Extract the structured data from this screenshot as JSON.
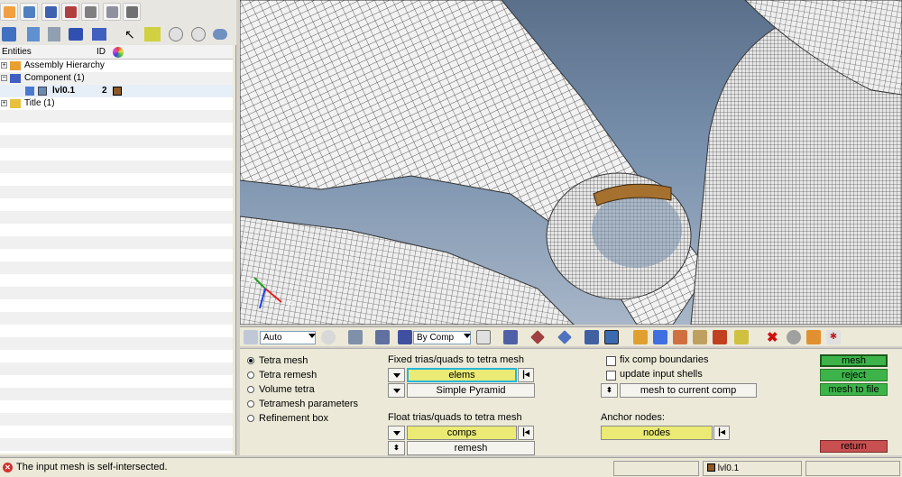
{
  "browser": {
    "header": {
      "entities": "Entities",
      "id": "ID"
    },
    "tree": [
      {
        "label": "Assembly Hierarchy",
        "id": ""
      },
      {
        "label": "Component (1)",
        "id": ""
      },
      {
        "label": "lvl0.1",
        "id": "2"
      },
      {
        "label": "Title (1)",
        "id": ""
      }
    ]
  },
  "view_toolbar": {
    "display_mode": "Auto",
    "color_mode": "By Comp"
  },
  "panel": {
    "radios": [
      {
        "label": "Tetra mesh",
        "selected": true
      },
      {
        "label": "Tetra remesh",
        "selected": false
      },
      {
        "label": "Volume tetra",
        "selected": false
      },
      {
        "label": "Tetramesh parameters",
        "selected": false
      },
      {
        "label": "Refinement box",
        "selected": false
      }
    ],
    "fixed_label": "Fixed trias/quads to tetra mesh",
    "fixed_selector": "elems",
    "fixed_type": "Simple Pyramid",
    "float_label": "Float trias/quads to tetra mesh",
    "float_selector": "comps",
    "float_type": "remesh",
    "fix_comp_boundaries": "fix comp boundaries",
    "update_input_shells": "update input shells",
    "mesh_dest": "mesh to current comp",
    "anchor_label": "Anchor nodes:",
    "anchor_selector": "nodes",
    "actions": {
      "mesh": "mesh",
      "reject": "reject",
      "mesh_to_file": "mesh to file",
      "return": "return"
    }
  },
  "status": {
    "message": "The input mesh is self-intersected.",
    "component": "lvl0.1"
  },
  "axes": {
    "x": "X",
    "y": "Y"
  },
  "colors": {
    "component": "#8b5a2b",
    "selector_yellow": "#eaea74",
    "action_green": "#3cb44a",
    "return_red": "#c85050"
  }
}
